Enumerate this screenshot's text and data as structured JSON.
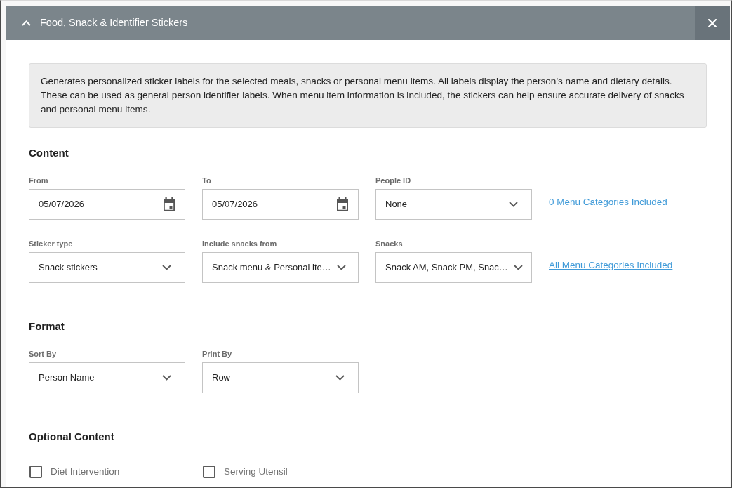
{
  "panel": {
    "title": "Food, Snack & Identifier Stickers",
    "expanded": true
  },
  "description": "Generates personalized sticker labels for the selected meals, snacks or personal menu items. All labels display the person's name and dietary details. These can be used as general person identifier labels. When menu item information is included, the stickers can help ensure accurate delivery of snacks and personal menu items.",
  "sections": [
    {
      "heading": "Content",
      "rows": [
        {
          "fields": [
            {
              "kind": "date",
              "label": "From",
              "value": "05/07/2026"
            },
            {
              "kind": "date",
              "label": "To",
              "value": "05/07/2026"
            },
            {
              "kind": "select",
              "label": "People ID",
              "value": "None"
            }
          ],
          "link": "0 Menu Categories Included"
        },
        {
          "fields": [
            {
              "kind": "select",
              "label": "Sticker type",
              "value": "Snack stickers"
            },
            {
              "kind": "select",
              "label": "Include snacks from",
              "value": "Snack menu & Personal ite…"
            },
            {
              "kind": "select",
              "label": "Snacks",
              "value": "Snack AM, Snack PM, Snac…"
            }
          ],
          "link": "All Menu Categories Included"
        }
      ]
    },
    {
      "heading": "Format",
      "rows": [
        {
          "fields": [
            {
              "kind": "select",
              "label": "Sort By",
              "value": "Person Name"
            },
            {
              "kind": "select",
              "label": "Print By",
              "value": "Row"
            }
          ]
        }
      ]
    },
    {
      "heading": "Optional Content",
      "checkboxes": [
        {
          "label": "Diet Intervention",
          "checked": false
        },
        {
          "label": "Serving Utensil",
          "checked": false
        }
      ]
    }
  ]
}
